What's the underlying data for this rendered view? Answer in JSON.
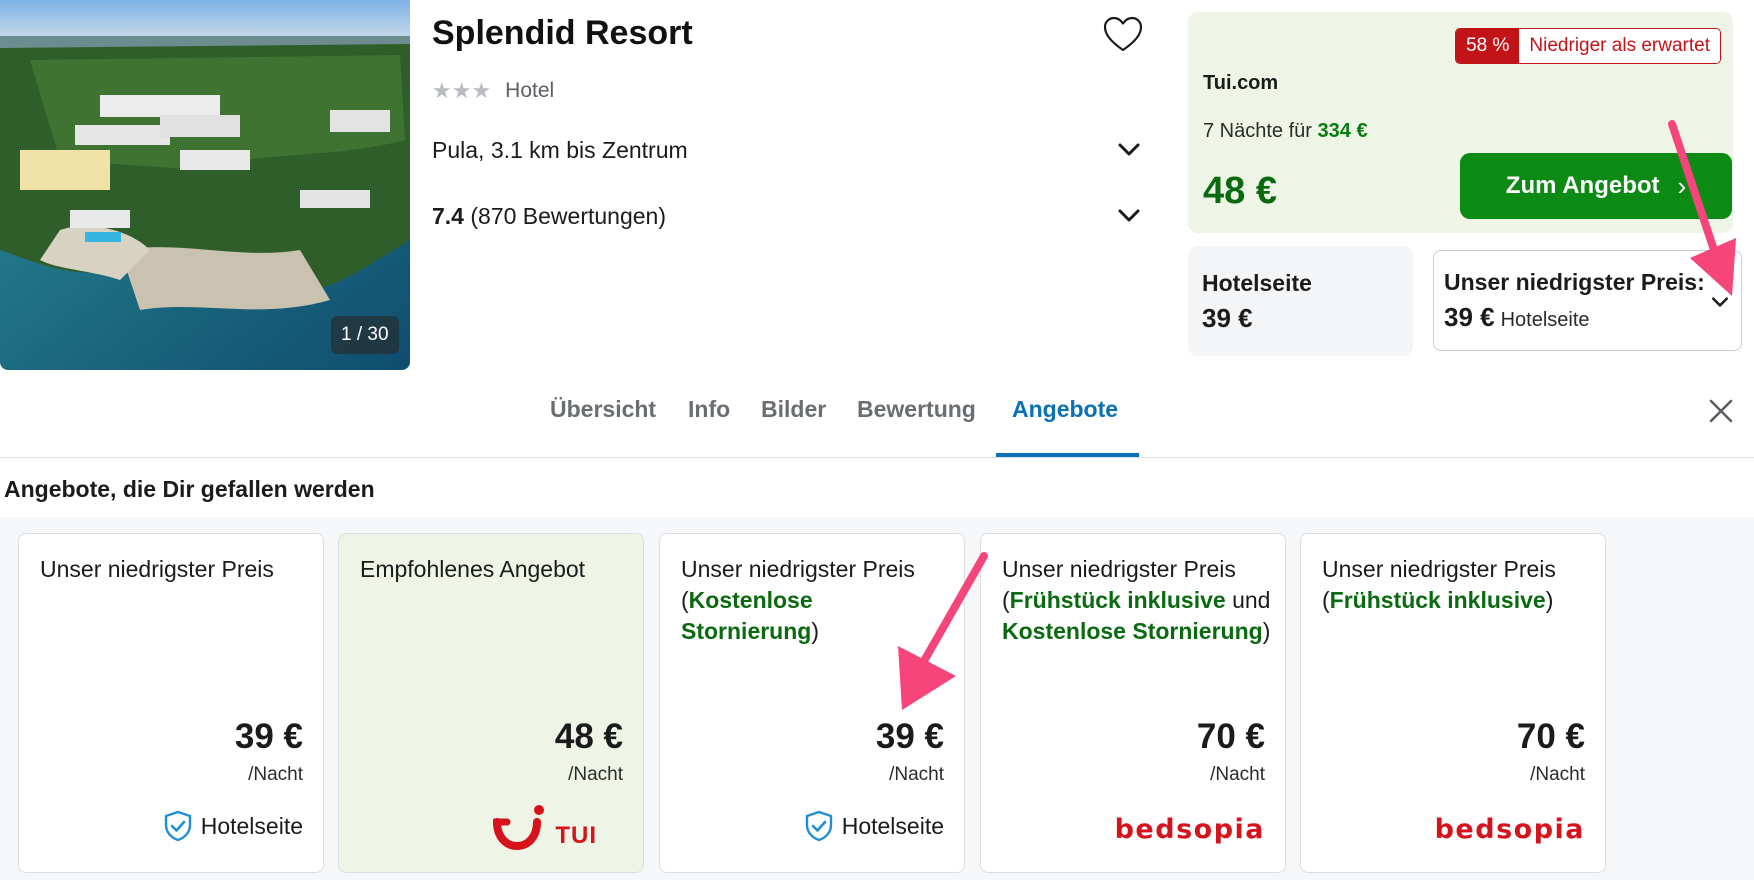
{
  "hotel": {
    "name": "Splendid Resort",
    "stars": "★★★",
    "type": "Hotel",
    "location": "Pula, 3.1 km bis Zentrum",
    "rating_score": "7.4",
    "rating_count": "(870 Bewertungen)",
    "image_counter": "1 / 30"
  },
  "deal": {
    "badge_percent": "58 %",
    "badge_label": "Niedriger als erwartet",
    "provider": "Tui.com",
    "nights_prefix": "7 Nächte für",
    "nights_price": "334 €",
    "price": "48 €",
    "button_label": "Zum Angebot",
    "button_arrow": "›"
  },
  "hotel_site": {
    "title": "Hotelseite",
    "price": "39 €"
  },
  "lowest_price": {
    "title": "Unser niedrigster Preis:",
    "price": "39 €",
    "source": "Hotelseite"
  },
  "tabs": [
    {
      "label": "Übersicht"
    },
    {
      "label": "Info"
    },
    {
      "label": "Bilder"
    },
    {
      "label": "Bewertung"
    },
    {
      "label": "Angebote"
    }
  ],
  "active_tab": "Angebote",
  "offers_section": {
    "title": "Angebote, die Dir gefallen werden"
  },
  "offers": [
    {
      "title": "Unser niedrigster Preis",
      "price": "39 €",
      "per": "/Nacht",
      "source": "Hotelseite"
    },
    {
      "title": "Empfohlenes Angebot",
      "price": "48 €",
      "per": "/Nacht",
      "source": "TUI"
    },
    {
      "title_parts": [
        "Unser niedrigster Preis",
        "(",
        "Kostenlose Stornierung",
        ")"
      ],
      "price": "39 €",
      "per": "/Nacht",
      "source": "Hotelseite"
    },
    {
      "title_parts": [
        "Unser niedrigster Preis",
        "(",
        "Frühstück inklusive",
        " und ",
        "Kostenlose Stornierung",
        ")"
      ],
      "price": "70 €",
      "per": "/Nacht",
      "source": "bedsopia"
    },
    {
      "title_parts": [
        "Unser niedrigster Preis",
        "(",
        "Frühstück inklusive",
        ")"
      ],
      "price": "70 €",
      "per": "/Nacht",
      "source": "bedsopia"
    }
  ],
  "colors": {
    "brand_green": "#0b8a14",
    "price_green": "#0a6a10",
    "tab_active": "#0a71b8",
    "badge_red": "#c21319",
    "annotation_pink": "#f5457a"
  },
  "icons": {
    "favorite": "heart-icon",
    "expand": "chevron-down-icon",
    "close": "close-icon",
    "verified": "shield-check-icon"
  }
}
